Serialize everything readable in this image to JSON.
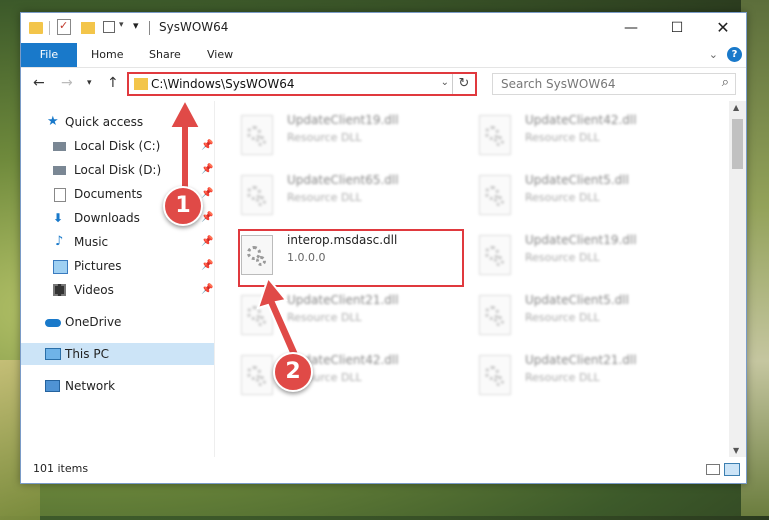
{
  "window": {
    "title": "SysWOW64"
  },
  "ribbon": {
    "file": "File",
    "home": "Home",
    "share": "Share",
    "view": "View"
  },
  "address": {
    "path": "C:\\Windows\\SysWOW64"
  },
  "search": {
    "placeholder": "Search SysWOW64"
  },
  "sidebar": {
    "items": [
      {
        "label": "Quick access",
        "icon": "star-icon"
      },
      {
        "label": "Local Disk (C:)",
        "icon": "drive-icon",
        "pinned": true
      },
      {
        "label": "Local Disk (D:)",
        "icon": "drive-icon",
        "pinned": true
      },
      {
        "label": "Documents",
        "icon": "documents-icon",
        "pinned": true
      },
      {
        "label": "Downloads",
        "icon": "download-icon",
        "pinned": true
      },
      {
        "label": "Music",
        "icon": "music-icon",
        "pinned": true
      },
      {
        "label": "Pictures",
        "icon": "pictures-icon",
        "pinned": true
      },
      {
        "label": "Videos",
        "icon": "videos-icon",
        "pinned": true
      },
      {
        "label": "OneDrive",
        "icon": "cloud-icon"
      },
      {
        "label": "This PC",
        "icon": "computer-icon",
        "selected": true
      },
      {
        "label": "Network",
        "icon": "network-icon"
      }
    ]
  },
  "files": [
    {
      "name": "UpdateClient19.dll",
      "desc": "Resource DLL"
    },
    {
      "name": "UpdateClient42.dll",
      "desc": "Resource DLL"
    },
    {
      "name": "UpdateClient65.dll",
      "desc": "Resource DLL"
    },
    {
      "name": "UpdateClient5.dll",
      "desc": "Resource DLL"
    },
    {
      "name": "interop.msdasc.dll",
      "desc": "1.0.0.0",
      "highlighted": true
    },
    {
      "name": "UpdateClient19.dll",
      "desc": "Resource DLL"
    },
    {
      "name": "UpdateClient21.dll",
      "desc": "Resource DLL"
    },
    {
      "name": "UpdateClient5.dll",
      "desc": "Resource DLL"
    },
    {
      "name": "UpdateClient42.dll",
      "desc": "Resource DLL"
    },
    {
      "name": "UpdateClient21.dll",
      "desc": "Resource DLL"
    }
  ],
  "status": {
    "count": "101 items"
  },
  "annotations": {
    "step1": "1",
    "step2": "2",
    "color": "#e04a47"
  }
}
